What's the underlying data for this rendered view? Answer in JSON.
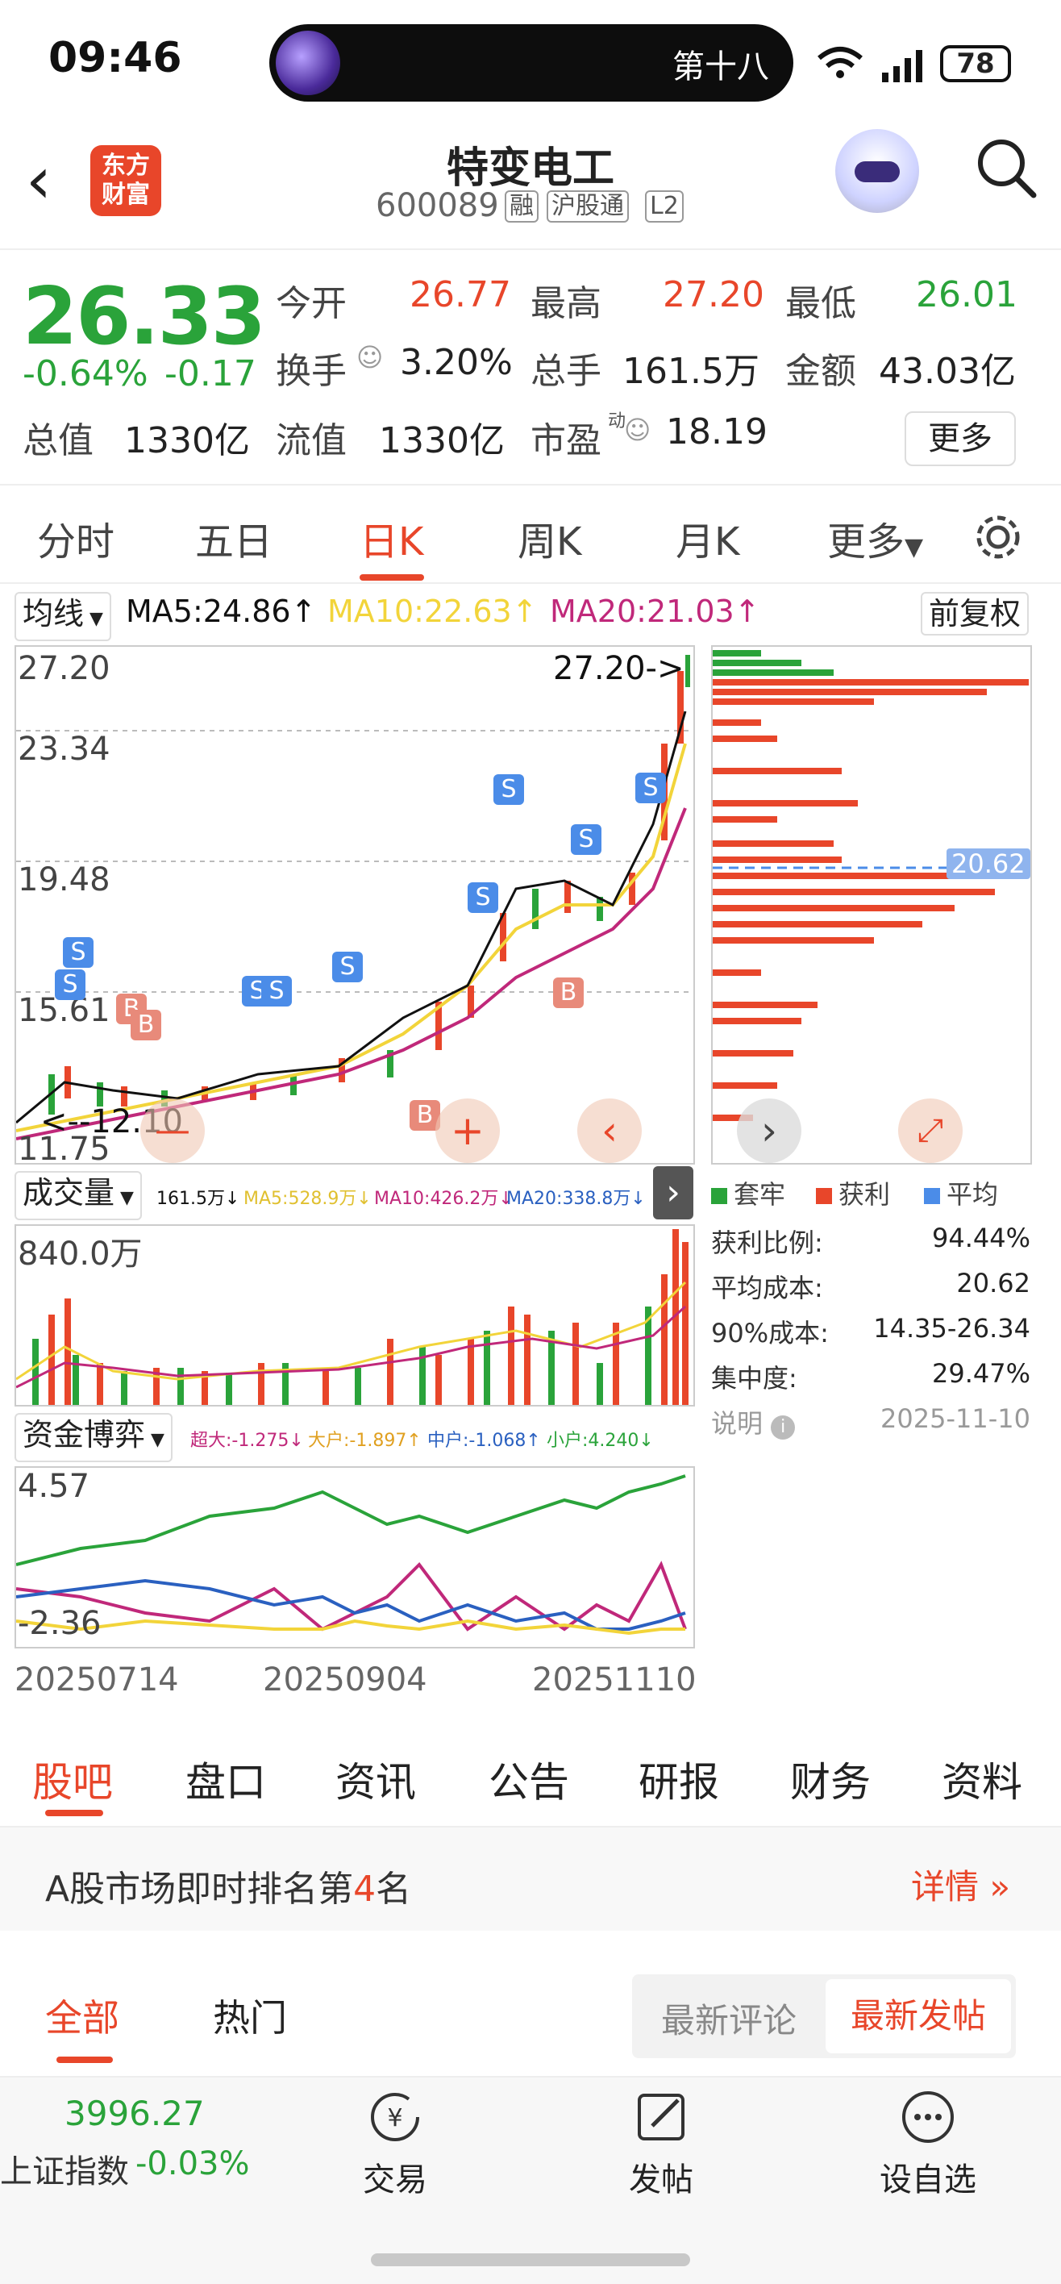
{
  "status": {
    "time": "09:46",
    "island_text": "第十八",
    "battery": "78"
  },
  "header": {
    "logo_line1": "东方",
    "logo_line2": "财富",
    "title": "特变电工",
    "code": "600089",
    "tags": [
      "融",
      "沪股通",
      "L2"
    ]
  },
  "quote": {
    "price": "26.33",
    "pct": "-0.64%",
    "chg": "-0.17",
    "open_label": "今开",
    "open": "26.77",
    "high_label": "最高",
    "high": "27.20",
    "low_label": "最低",
    "low": "26.01",
    "turnover_label": "换手",
    "turnover": "3.20%",
    "vol_label": "总手",
    "vol": "161.5万",
    "amount_label": "金额",
    "amount": "43.03亿",
    "mcap_label": "总值",
    "mcap": "1330亿",
    "float_label": "流值",
    "float": "1330亿",
    "pe_label": "市盈",
    "pe_sup": "动",
    "pe": "18.19",
    "more": "更多"
  },
  "tabs": [
    "分时",
    "五日",
    "日K",
    "周K",
    "月K",
    "更多"
  ],
  "ma_bar": {
    "selector": "均线",
    "ma5": "MA5:24.86↑",
    "ma10": "MA10:22.63↑",
    "ma20": "MA20:21.03↑",
    "adjust": "前复权"
  },
  "kline": {
    "y_labels": [
      "27.20",
      "23.34",
      "19.48",
      "15.61",
      "11.75"
    ],
    "high_marker": "27.20->",
    "low_marker": "<--12.10",
    "markers": [
      "S",
      "S",
      "B",
      "B",
      "S",
      "S",
      "S",
      "S",
      "S",
      "S",
      "S",
      "B",
      "B"
    ]
  },
  "chips": {
    "avg_label": "20.62",
    "legend": [
      "套牢",
      "获利",
      "平均"
    ],
    "stats": [
      {
        "label": "获利比例:",
        "value": "94.44%"
      },
      {
        "label": "平均成本:",
        "value": "20.62"
      },
      {
        "label": "90%成本:",
        "value": "14.35-26.34"
      },
      {
        "label": "集中度:",
        "value": "29.47%"
      },
      {
        "label": "说明",
        "value": "2025-11-10"
      }
    ]
  },
  "volume": {
    "selector": "成交量",
    "v": "161.5万↓",
    "ma5": "MA5:528.9万↓",
    "ma10": "MA10:426.2万↓",
    "ma20": "MA20:338.8万↓",
    "ymax": "840.0万"
  },
  "fund": {
    "selector": "资金博弈",
    "super": "超大:-1.275↓",
    "big": "大户:-1.897↑",
    "mid": "中户:-1.068↑",
    "small": "小户:4.240↓",
    "ymax": "4.57",
    "ymin": "-2.36",
    "dates": [
      "20250714",
      "20250904",
      "20251110"
    ]
  },
  "bottom_tabs": [
    "股吧",
    "盘口",
    "资讯",
    "公告",
    "研报",
    "财务",
    "资料"
  ],
  "rank": {
    "prefix": "A股市场即时排名第",
    "num": "4",
    "suffix": "名",
    "detail": "详情"
  },
  "subtabs": {
    "all": "全部",
    "hot": "热门",
    "latest_comment": "最新评论",
    "latest_post": "最新发帖"
  },
  "dock": {
    "index_value": "3996.27",
    "index_name": "上证指数",
    "index_pct": "-0.03%",
    "trade": "交易",
    "post": "发帖",
    "watch": "设自选"
  },
  "colors": {
    "up": "#e8462a",
    "down": "#2aa33a",
    "ma5": "#111111",
    "ma10": "#f2d43a",
    "ma20": "#c0287a"
  }
}
